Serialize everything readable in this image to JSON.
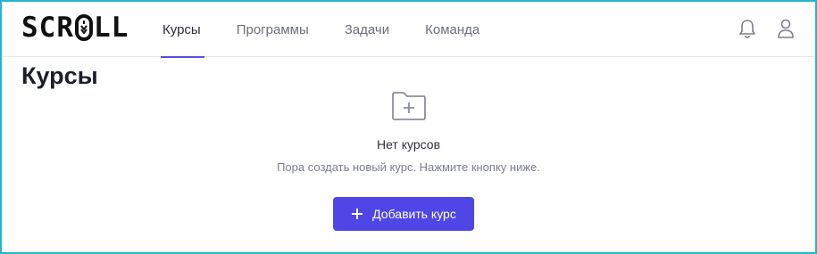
{
  "app": {
    "logo_prefix": "SCR",
    "logo_suffix": "LL",
    "accent_color": "#4f46e5",
    "frame_color": "#22b6c9"
  },
  "nav": {
    "items": [
      {
        "label": "Курсы",
        "active": true
      },
      {
        "label": "Программы",
        "active": false
      },
      {
        "label": "Задачи",
        "active": false
      },
      {
        "label": "Команда",
        "active": false
      }
    ]
  },
  "header_icons": [
    "bell-icon",
    "user-icon"
  ],
  "page": {
    "title": "Курсы"
  },
  "empty_state": {
    "icon": "folder-plus-icon",
    "title": "Нет курсов",
    "subtitle": "Пора создать новый курс. Нажмите кнопку ниже."
  },
  "actions": {
    "add_course_label": "Добавить курс",
    "add_course_icon": "plus-icon"
  }
}
